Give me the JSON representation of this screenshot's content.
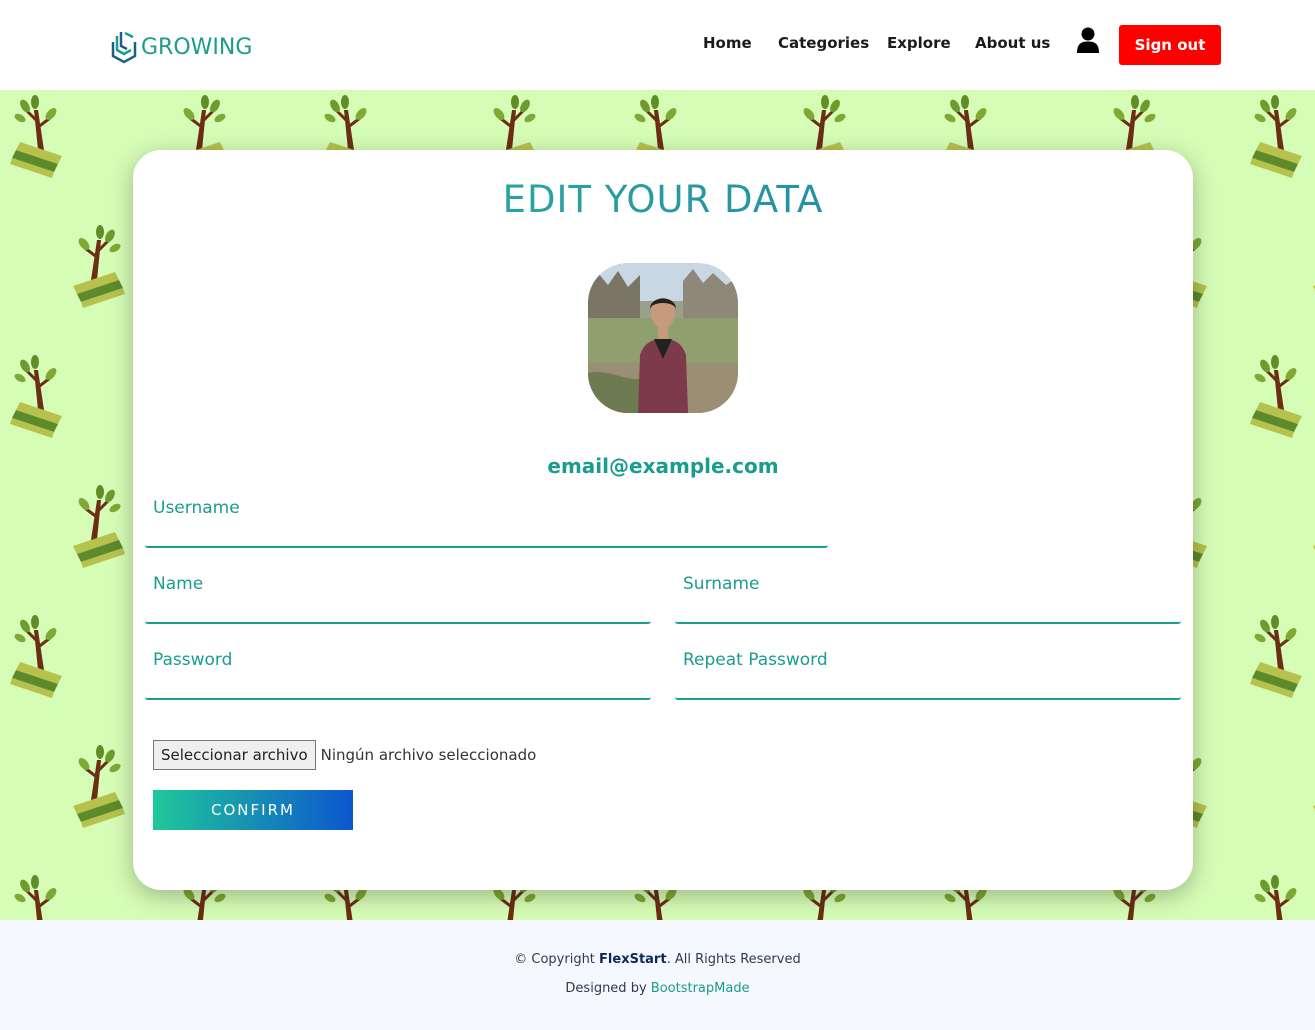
{
  "header": {
    "logo_text": "GROWING",
    "nav": [
      "Home",
      "Categories",
      "Explore",
      "About us"
    ],
    "signout_label": "Sign out"
  },
  "main": {
    "title": "EDIT YOUR DATA",
    "email": "email@example.com",
    "fields": {
      "username": "Username",
      "name": "Name",
      "surname": "Surname",
      "password": "Password",
      "repeat_password": "Repeat Password"
    },
    "file": {
      "button_label": "Seleccionar archivo",
      "status": "Ningún archivo seleccionado"
    },
    "confirm_label": "CONFIRM"
  },
  "footer": {
    "copyright_prefix": "© Copyright",
    "brand": "FlexStart",
    "copyright_suffix": ". All Rights Reserved",
    "designed_by": "Designed by",
    "designer": "BootstrapMade"
  },
  "colors": {
    "accent": "#1a9c8f",
    "signout": "#ff0000",
    "background_pattern": "#d6fdb6",
    "footer_bg": "#f5f8fe"
  },
  "icons": [
    "logo-mark-icon",
    "user-icon"
  ]
}
